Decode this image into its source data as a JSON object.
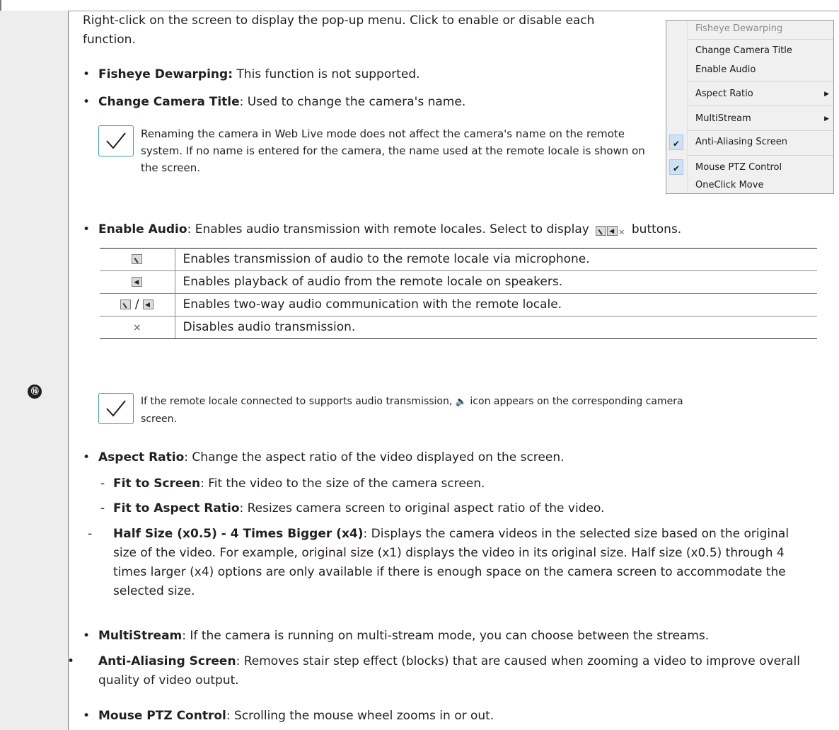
{
  "item_number": "⑯",
  "intro": "Right-click on the screen to display the pop-up menu. Click to enable or disable each function.",
  "bullets_top": [
    {
      "term": "Fisheye Dewarping:",
      "text": " This function is not supported."
    },
    {
      "term": "Change Camera Title",
      "text": ": Used to change the camera's name."
    }
  ],
  "note1": "Renaming the camera in Web Live mode does not affect the camera's name on the remote system. If no name is entered for the camera, the name used at the remote locale is shown on the screen.",
  "popup_menu": {
    "items": [
      {
        "label": "Fisheye Dewarping",
        "disabled": true
      },
      {
        "label": "Change Camera Title"
      },
      {
        "label": "Enable Audio"
      },
      {
        "label": "Aspect Ratio",
        "submenu": true
      },
      {
        "label": "MultiStream",
        "submenu": true
      },
      {
        "label": "Anti-Aliasing Screen",
        "checked": true
      },
      {
        "label": "Mouse PTZ Control",
        "checked": true
      },
      {
        "label": "OneClick Move"
      }
    ]
  },
  "enable_audio": {
    "term": "Enable Audio",
    "text_before": ": Enables audio transmission with remote locales. Select to display",
    "text_after": "buttons."
  },
  "audio_table": [
    {
      "icon": "mic-button-icon",
      "desc": "Enables transmission of audio to the remote locale via microphone."
    },
    {
      "icon": "speaker-button-icon",
      "desc": "Enables playback of audio from the remote locale on speakers."
    },
    {
      "icon": "mic-speaker-button-icon",
      "separator": "/",
      "desc": "Enables two-way audio communication with the remote locale."
    },
    {
      "icon": "close-x-icon",
      "symbol": "×",
      "desc": "Disables audio transmission."
    }
  ],
  "note2_before": "If the remote locale connected to supports audio transmission,",
  "note2_after": "icon appears on the corresponding camera screen.",
  "aspect": {
    "term": "Aspect Ratio",
    "text": ": Change the aspect ratio of the video displayed on the screen."
  },
  "aspect_subs": [
    {
      "term": "Fit to Screen",
      "text": ": Fit the video to the size of the camera screen."
    },
    {
      "term": "Fit to Aspect Ratio",
      "text": ": Resizes camera screen to original aspect ratio of the video."
    },
    {
      "term": "Half Size (x0.5) - 4 Times Bigger (x4)",
      "text": ": Displays the camera videos in the selected size based on the original size of the video. For example, original size (x1) displays the video in its original size. Half size (x0.5) through 4 times larger (x4) options are only available if there is enough space on the camera screen to accommodate the selected size."
    }
  ],
  "bullets_bottom": [
    {
      "term": "MultiStream",
      "text": ": If the camera is running on multi-stream mode, you can choose between the streams."
    },
    {
      "term": "Anti-Aliasing Screen",
      "text": ": Removes stair step effect (blocks) that are caused when zooming a video to improve overall quality of video output."
    },
    {
      "term": "Mouse PTZ Control",
      "text": ": Scrolling the mouse wheel zooms in or out."
    }
  ],
  "colors": {
    "note_accent": "#3aa0a8",
    "left_column": "#ededed",
    "menu_check_bg": "#cfe1f3"
  }
}
